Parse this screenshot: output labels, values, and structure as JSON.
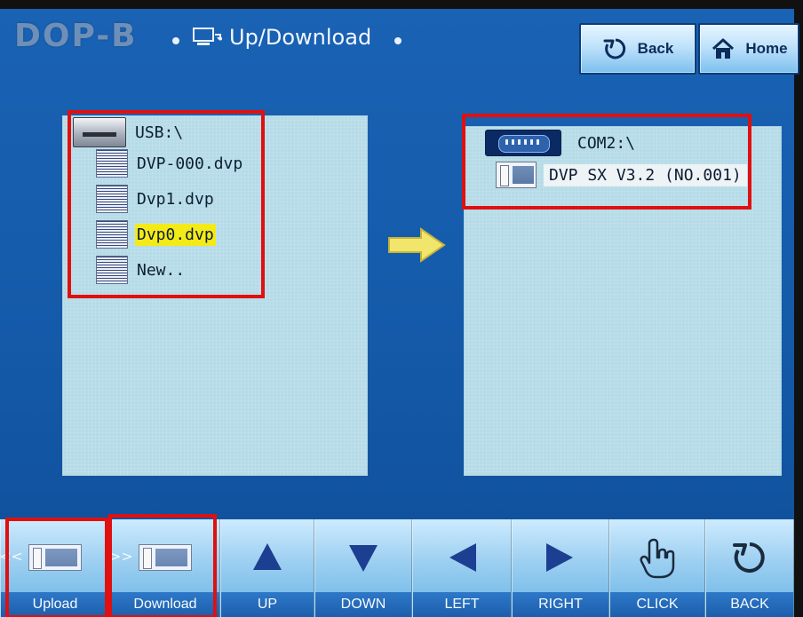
{
  "header": {
    "brand": "DOP-B",
    "title": "Up/Download",
    "buttons": {
      "back": "Back",
      "home": "Home"
    }
  },
  "panels": {
    "left": {
      "root": "USB:\\",
      "items": [
        "DVP-000.dvp",
        "Dvp1.dvp",
        "Dvp0.dvp",
        "New.."
      ],
      "selected_index": 2
    },
    "right": {
      "root": "COM2:\\",
      "items": [
        "DVP SX V3.2 (NO.001)"
      ]
    }
  },
  "toolbar": {
    "buttons": [
      {
        "label": "Upload",
        "icon": "upload-icon"
      },
      {
        "label": "Download",
        "icon": "download-icon"
      },
      {
        "label": "UP",
        "icon": "up-arrow-icon"
      },
      {
        "label": "DOWN",
        "icon": "down-arrow-icon"
      },
      {
        "label": "LEFT",
        "icon": "left-arrow-icon"
      },
      {
        "label": "RIGHT",
        "icon": "right-arrow-icon"
      },
      {
        "label": "CLICK",
        "icon": "hand-click-icon"
      },
      {
        "label": "BACK",
        "icon": "back-refresh-icon"
      }
    ]
  },
  "colors": {
    "highlight_red": "#e01010",
    "selected_yellow": "#f4ea18",
    "screen_blue": "#145aa9"
  }
}
